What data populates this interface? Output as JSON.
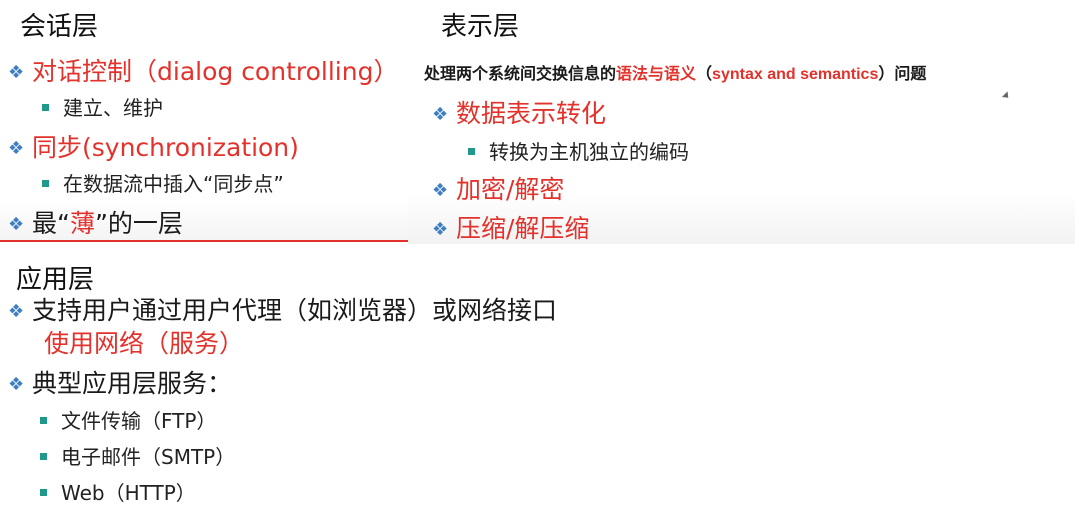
{
  "colors": {
    "diamond": "#3f7fbf",
    "square": "#1f9a8a",
    "accent_red": "#e3322c",
    "divider": "#e3322c"
  },
  "session": {
    "heading": "会话层",
    "items": [
      {
        "bullet": "diamond-icon",
        "text": "对话控制（dialog controlling）"
      },
      {
        "bullet": "square-bullet-icon",
        "text": "建立、维护"
      },
      {
        "bullet": "diamond-icon",
        "text": "同步(synchronization)"
      },
      {
        "bullet": "square-bullet-icon",
        "text": "在数据流中插入“同步点”"
      },
      {
        "bullet": "diamond-icon",
        "text_parts": [
          "最“",
          "薄",
          "”的一层"
        ]
      }
    ]
  },
  "presentation": {
    "heading": "表示层",
    "subtitle_parts": [
      "处理两个系统间交换信息的",
      "语法与语义",
      "（",
      "syntax and semantics",
      "）问题"
    ],
    "items": [
      {
        "bullet": "diamond-icon",
        "text": "数据表示转化"
      },
      {
        "bullet": "square-bullet-icon",
        "text": "转换为主机独立的编码"
      },
      {
        "bullet": "diamond-icon",
        "text": "加密/解密"
      },
      {
        "bullet": "diamond-icon",
        "text": "压缩/解压缩"
      }
    ]
  },
  "application": {
    "heading": "应用层",
    "items": [
      {
        "bullet": "diamond-icon",
        "text": "支持用户通过用户代理（如浏览器）或网络接口"
      },
      {
        "bullet": "none",
        "text": "使用网络（服务）"
      },
      {
        "bullet": "diamond-icon",
        "text": "典型应用层服务："
      },
      {
        "bullet": "square-bullet-icon",
        "text": "文件传输（FTP）"
      },
      {
        "bullet": "square-bullet-icon",
        "text": "电子邮件（SMTP）"
      },
      {
        "bullet": "square-bullet-icon",
        "text": "Web（HTTP）"
      }
    ]
  }
}
